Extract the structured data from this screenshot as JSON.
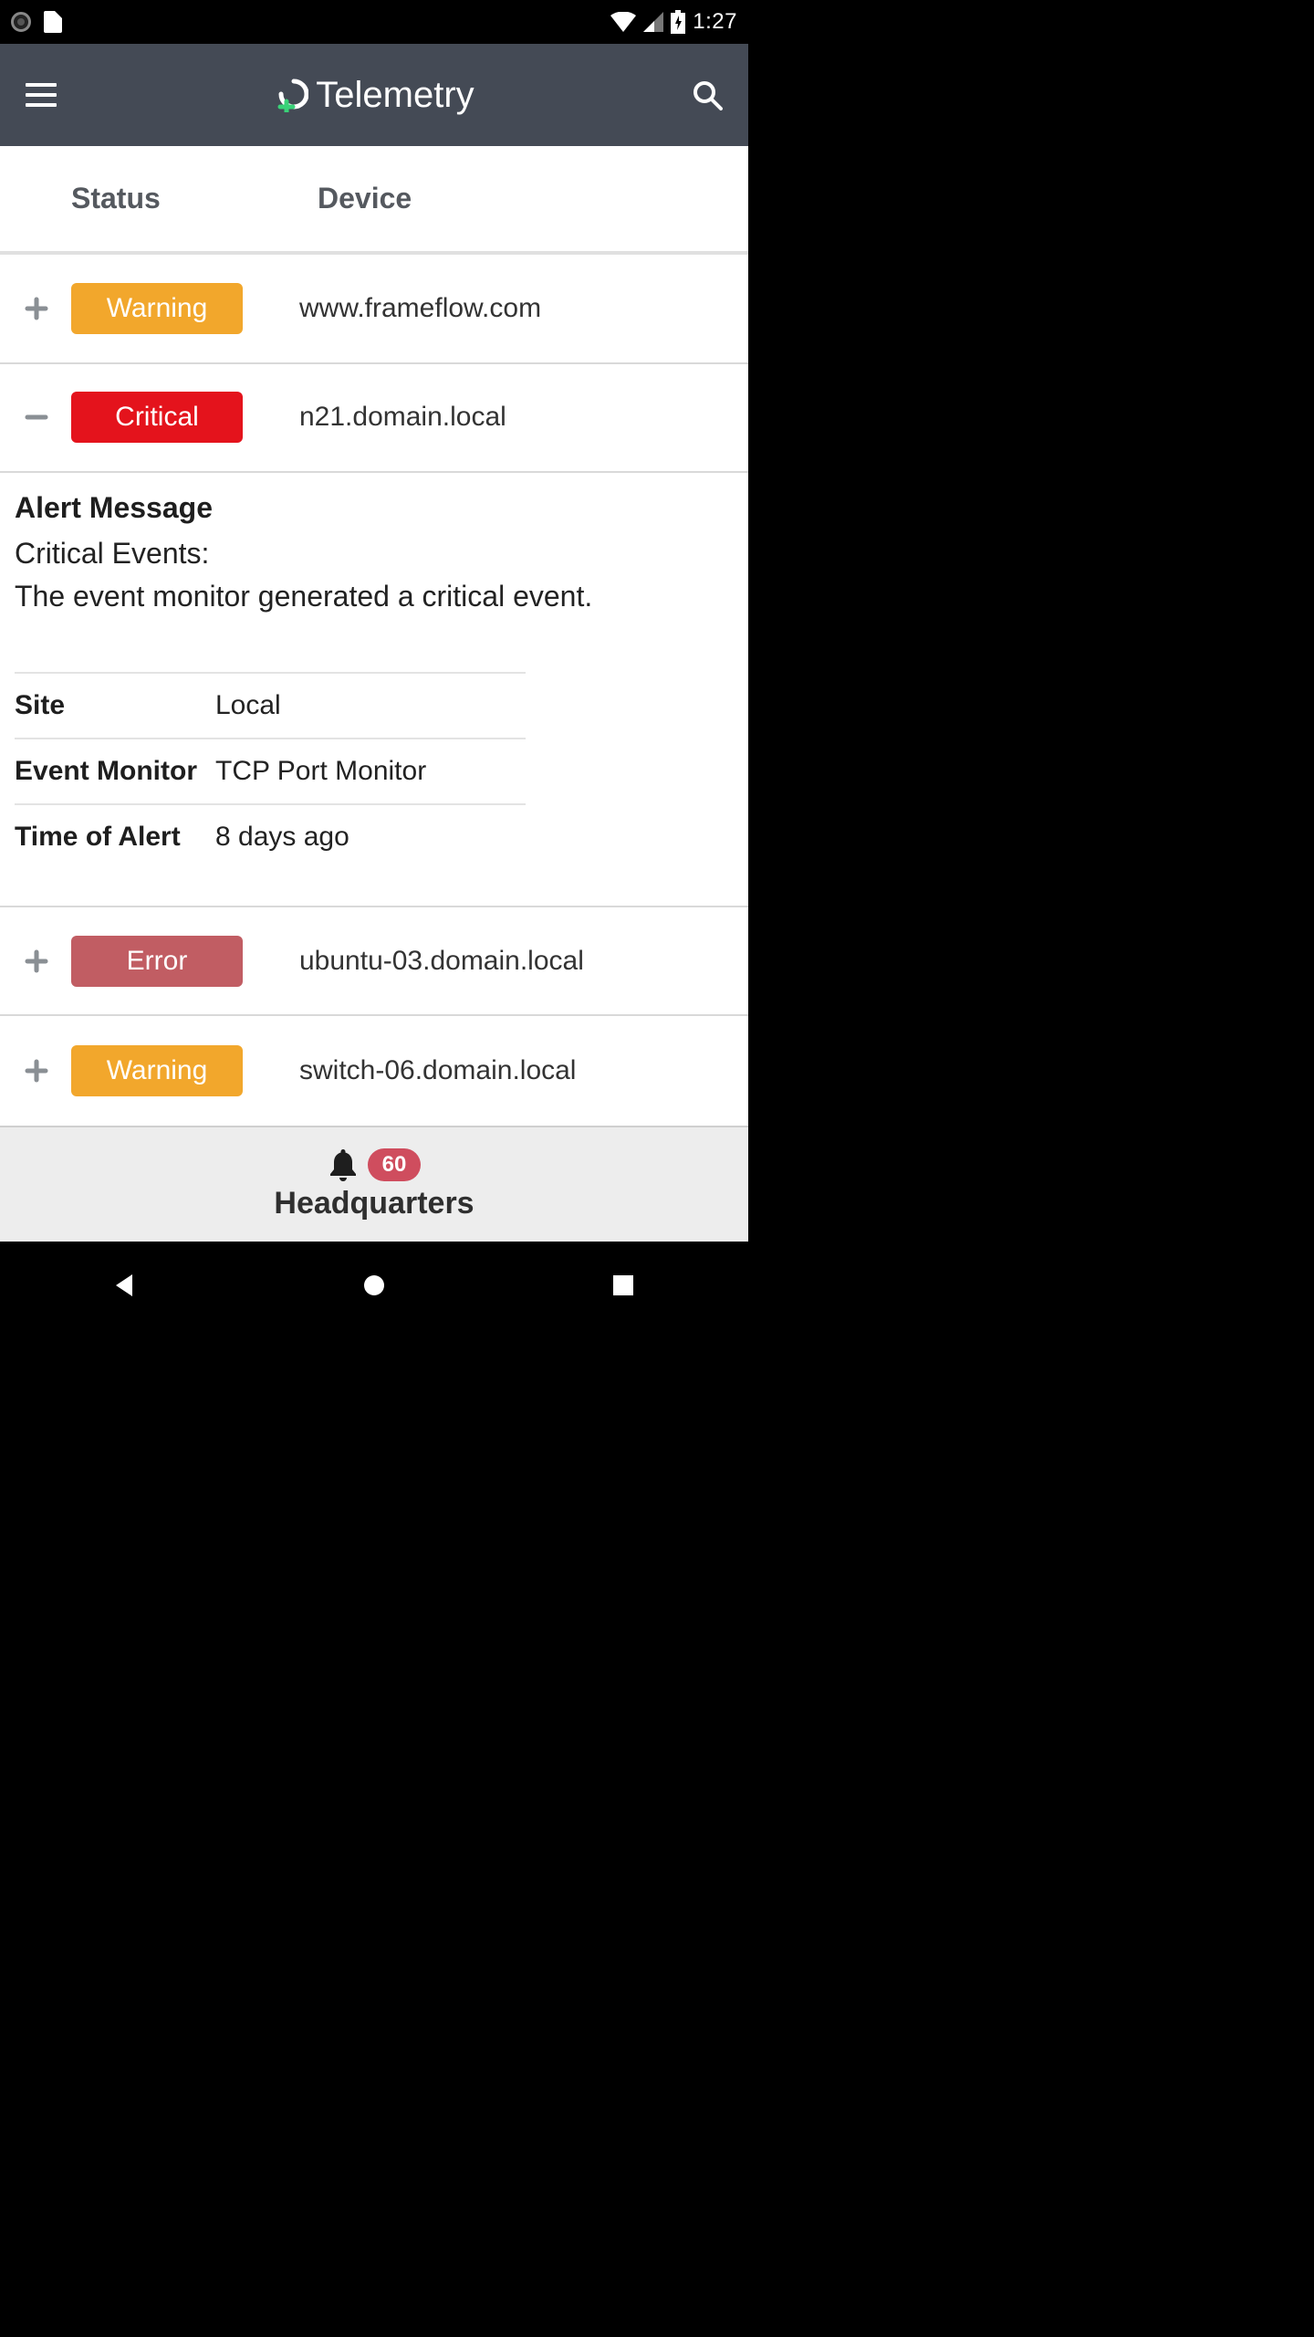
{
  "statusbar": {
    "time": "1:27"
  },
  "appbar": {
    "title": "Telemetry"
  },
  "table": {
    "headers": {
      "status": "Status",
      "device": "Device"
    },
    "rows": [
      {
        "status": "Warning",
        "status_class": "warning",
        "device": "www.frameflow.com",
        "expanded": false
      },
      {
        "status": "Critical",
        "status_class": "critical",
        "device": "n21.domain.local",
        "expanded": true
      },
      {
        "status": "Error",
        "status_class": "error",
        "device": "ubuntu-03.domain.local",
        "expanded": false
      },
      {
        "status": "Warning",
        "status_class": "warning",
        "device": "switch-06.domain.local",
        "expanded": false
      }
    ]
  },
  "detail": {
    "heading": "Alert Message",
    "line1": "Critical Events:",
    "line2": "The event monitor generated a critical event.",
    "fields": {
      "site_label": "Site",
      "site_value": "Local",
      "monitor_label": "Event Monitor",
      "monitor_value": "TCP Port Monitor",
      "time_label": "Time of Alert",
      "time_value": "8 days ago"
    }
  },
  "footer": {
    "count": "60",
    "label": "Headquarters"
  }
}
